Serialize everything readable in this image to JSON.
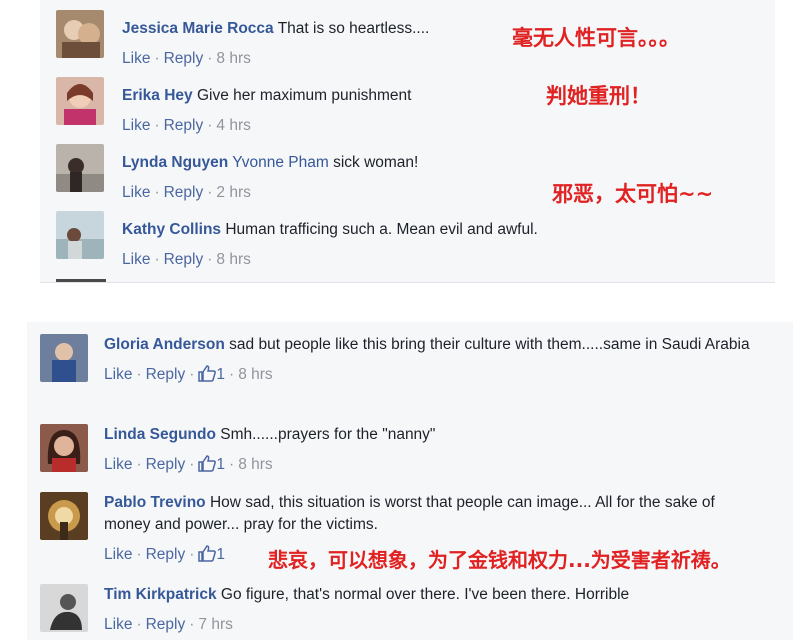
{
  "top_comments": [
    {
      "author": "Jessica Marie Rocca",
      "text": "That is so heartless....",
      "like": "Like",
      "reply": "Reply",
      "time": "8 hrs"
    },
    {
      "author": "Erika Hey",
      "text": "Give her maximum punishment",
      "like": "Like",
      "reply": "Reply",
      "time": "4 hrs"
    },
    {
      "author": "Lynda Nguyen",
      "mention": "Yvonne Pham",
      "text": "sick woman!",
      "like": "Like",
      "reply": "Reply",
      "time": "2 hrs"
    },
    {
      "author": "Kathy Collins",
      "text": "Human trafficing such a. Mean evil and awful.",
      "like": "Like",
      "reply": "Reply",
      "time": "8 hrs"
    }
  ],
  "bottom_comments": [
    {
      "author": "Gloria Anderson",
      "text": "sad but people like this bring their culture with them.....same in Saudi Arabia",
      "like": "Like",
      "reply": "Reply",
      "likes": "1",
      "time": "8 hrs"
    },
    {
      "author": "Linda Segundo",
      "text": "Smh......prayers for the \"nanny\"",
      "like": "Like",
      "reply": "Reply",
      "likes": "1",
      "time": "8 hrs"
    },
    {
      "author": "Pablo Trevino",
      "text": "How sad, this situation is worst that people can image... All for the sake of money and power... pray for the victims.",
      "like": "Like",
      "reply": "Reply",
      "likes": "1",
      "time": ""
    },
    {
      "author": "Tim Kirkpatrick",
      "text": "Go figure, that's normal over there. I've been there. Horrible",
      "like": "Like",
      "reply": "Reply",
      "time": "7 hrs"
    }
  ],
  "annotations": {
    "a1": "毫无人性可言。。。",
    "a2": "判她重刑！",
    "a3": "邪恶，太可怕~~",
    "a4": "悲哀，可以想象，为了金钱和权力...为受害者祈祷。"
  },
  "colors": {
    "author": "#365899",
    "link": "#4b67a1",
    "meta": "#90949c",
    "annotation": "#e02222",
    "panel": "#f6f7f9"
  },
  "icons": {
    "like_count": "thumbs-up-icon"
  }
}
